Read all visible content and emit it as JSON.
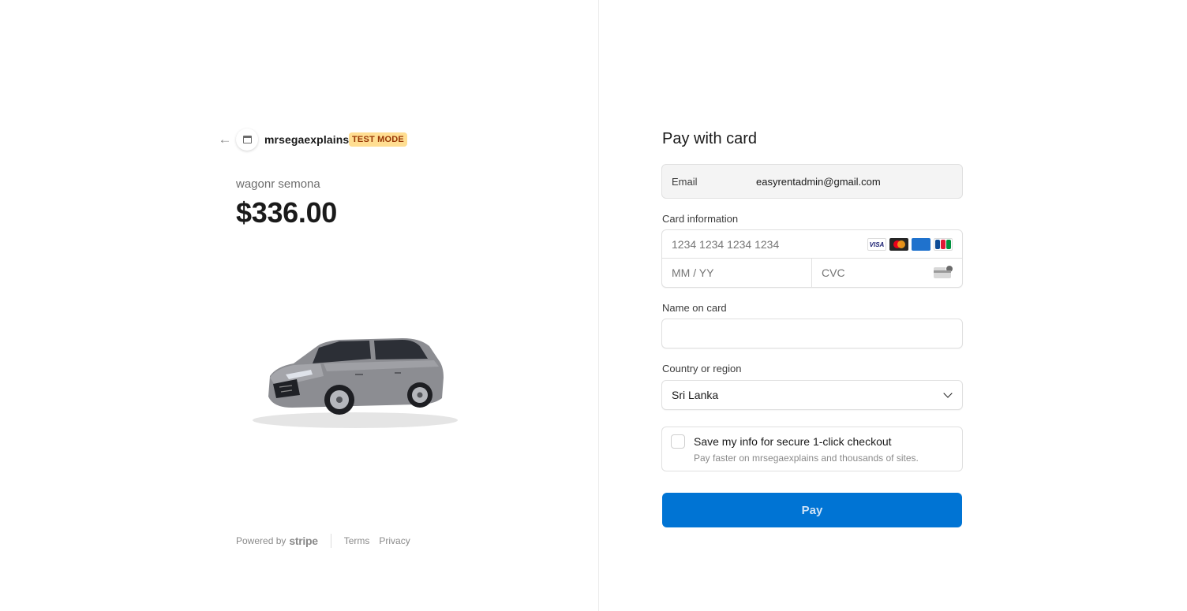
{
  "merchant": {
    "name": "mrsegaexplains",
    "badge": "TEST MODE"
  },
  "product": {
    "name": "wagonr semona",
    "price": "$336.00"
  },
  "footer": {
    "powered_by": "Powered by",
    "stripe": "stripe",
    "links": [
      "Terms",
      "Privacy"
    ]
  },
  "form": {
    "title": "Pay with card",
    "email_label": "Email",
    "email_value": "easyrentadmin@gmail.com",
    "card_label": "Card information",
    "card_number_placeholder": "1234 1234 1234 1234",
    "card_brands": [
      "VISA",
      "mastercard",
      "AMEX",
      "JCB"
    ],
    "expiry_placeholder": "MM / YY",
    "cvc_placeholder": "CVC",
    "name_label": "Name on card",
    "name_value": "",
    "country_label": "Country or region",
    "country_value": "Sri Lanka",
    "save_title": "Save my info for secure 1-click checkout",
    "save_subtitle": "Pay faster on mrsegaexplains and thousands of sites.",
    "save_checked": false,
    "pay_label": "Pay"
  },
  "colors": {
    "accent": "#0074d4",
    "badge_bg": "#ffde92",
    "badge_text": "#983705"
  }
}
